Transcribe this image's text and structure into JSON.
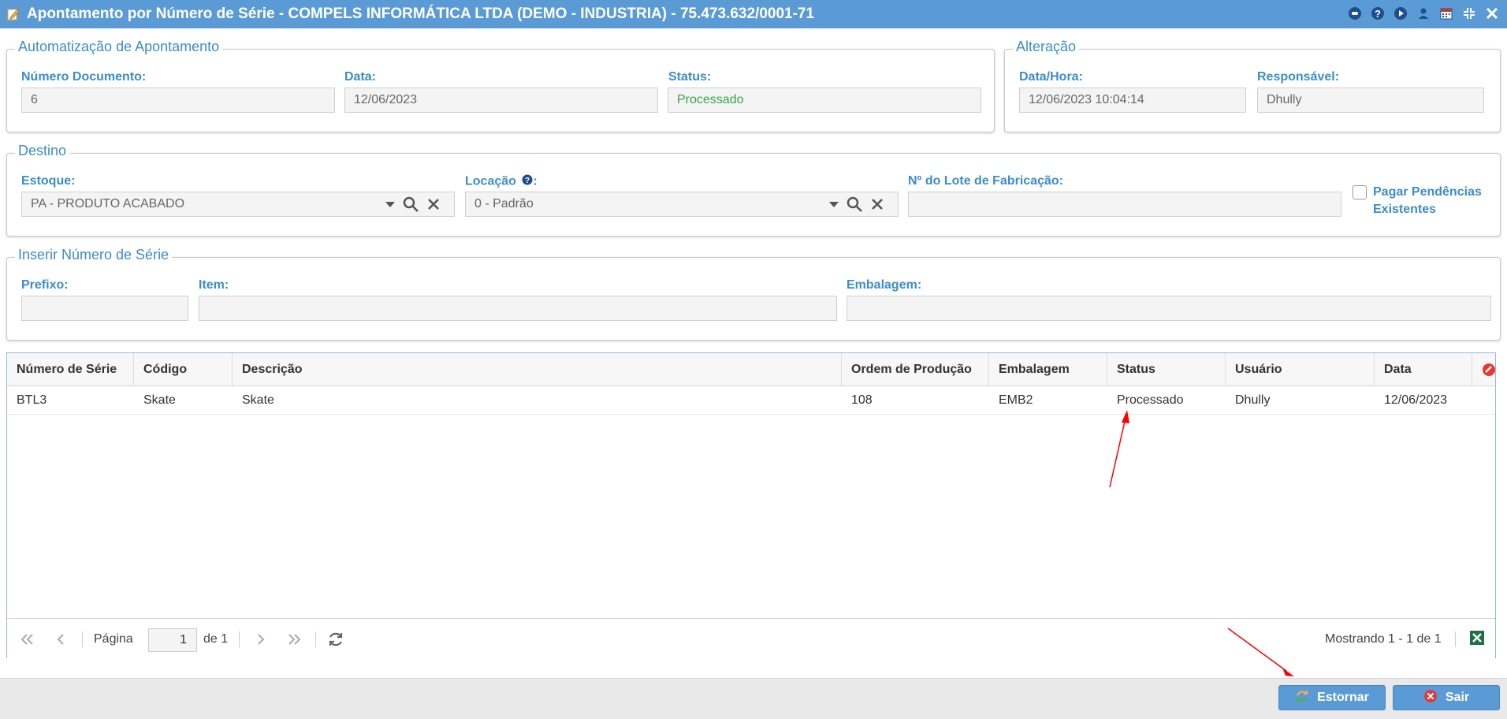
{
  "window": {
    "title": "Apontamento por Número de Série - COMPELS INFORMÁTICA LTDA (DEMO - INDUSTRIA) - 75.473.632/0001-71",
    "tool_icons": [
      "info-icon",
      "help-icon",
      "play-icon",
      "user-icon",
      "calendar-icon",
      "collapse-icon",
      "close-icon"
    ]
  },
  "automatizacao": {
    "legend": "Automatização de Apontamento",
    "numero_label": "Número Documento:",
    "numero_value": "6",
    "data_label": "Data:",
    "data_value": "12/06/2023",
    "status_label": "Status:",
    "status_value": "Processado"
  },
  "alteracao": {
    "legend": "Alteração",
    "datahora_label": "Data/Hora:",
    "datahora_value": "12/06/2023 10:04:14",
    "responsavel_label": "Responsável:",
    "responsavel_value": "Dhully"
  },
  "destino": {
    "legend": "Destino",
    "estoque_label": "Estoque:",
    "estoque_value": "PA - PRODUTO ACABADO",
    "locacao_label": "Locação",
    "locacao_suffix": ":",
    "locacao_value": "0 - Padrão",
    "lote_label": "Nº do Lote de Fabricação:",
    "lote_value": "",
    "pagar_label_1": "Pagar Pendências",
    "pagar_label_2": "Existentes"
  },
  "inserir": {
    "legend": "Inserir Número de Série",
    "prefixo_label": "Prefixo:",
    "item_label": "Item:",
    "embalagem_label": "Embalagem:"
  },
  "grid": {
    "columns": [
      "Número de Série",
      "Código",
      "Descrição",
      "Ordem de Produção",
      "Embalagem",
      "Status",
      "Usuário",
      "Data"
    ],
    "rows": [
      [
        "BTL3",
        "Skate",
        "Skate",
        "108",
        "EMB2",
        "Processado",
        "Dhully",
        "12/06/2023"
      ]
    ]
  },
  "pager": {
    "pagina_label": "Página",
    "page_value": "1",
    "de_label": "de 1",
    "showing": "Mostrando 1 - 1 de 1"
  },
  "footer": {
    "estornar_label": "Estornar",
    "sair_label": "Sair"
  },
  "colors": {
    "titlebar": "#5b9bd5",
    "label": "#3c8dc9",
    "status_green": "#3aa34a",
    "annotation_red": "#ff0000"
  }
}
